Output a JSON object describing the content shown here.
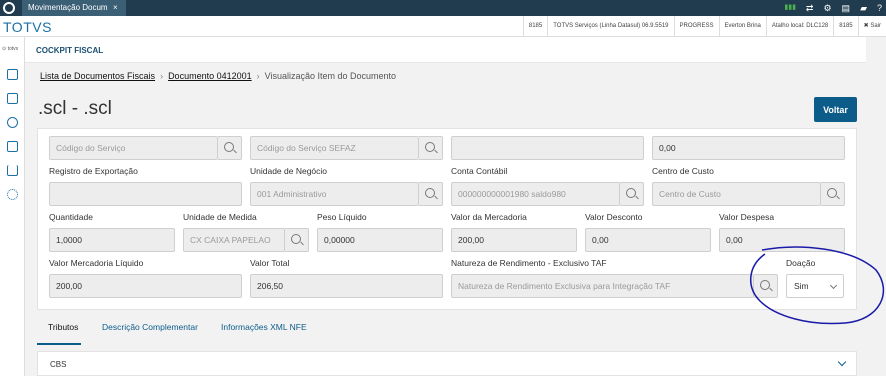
{
  "topbar": {
    "tab_label": "Movimentação Docum",
    "tab_close": "×",
    "icons": [
      "signal-icon",
      "shuffle-icon",
      "gear-icon",
      "document-icon",
      "chat-icon",
      "help-icon"
    ]
  },
  "header": {
    "brand": "TOTVS",
    "info": [
      "8185",
      "TOTVS Serviços (Linha Datasul) 06.9.5519",
      "PROGRESS",
      "Everton Brina",
      "Atalho local: DLC128",
      "8185",
      "✖ Sair"
    ]
  },
  "sidebar": {
    "brand": "⊙ totvs",
    "icons": [
      "document-icon",
      "calculator-icon",
      "dollar-icon",
      "file-icon",
      "download-icon",
      "gear-icon"
    ]
  },
  "module_title": "COCKPIT FISCAL",
  "breadcrumb": {
    "item1": "Lista de Documentos Fiscais",
    "item2": "Documento 0412001",
    "current": "Visualização Item do Documento",
    "sep": "›"
  },
  "page_title": ".scl - .scl",
  "voltar_label": "Voltar",
  "form": {
    "row0": {
      "codigo_servico_ph": "Código do Serviço",
      "codigo_sefaz_ph": "Código do Serviço SEFAZ",
      "campo3_value": "",
      "campo4_value": "0,00"
    },
    "row1": {
      "registro_label": "Registro de Exportação",
      "registro_value": "",
      "unidade_negocio_label": "Unidade de Negócio",
      "unidade_negocio_value": "001  Administrativo",
      "conta_label": "Conta Contábil",
      "conta_value": "000000000001980  saldo980",
      "centro_label": "Centro de Custo",
      "centro_ph": "Centro de Custo"
    },
    "row2": {
      "quantidade_label": "Quantidade",
      "quantidade_value": "1,0000",
      "unidade_medida_label": "Unidade de Medida",
      "unidade_medida_value": "CX  CAIXA PAPELAO",
      "peso_label": "Peso Líquido",
      "peso_value": "0,00000",
      "valor_merc_label": "Valor da Mercadoria",
      "valor_merc_value": "200,00",
      "valor_desc_label": "Valor Desconto",
      "valor_desc_value": "0,00",
      "valor_desp_label": "Valor Despesa",
      "valor_desp_value": "0,00"
    },
    "row3": {
      "vml_label": "Valor Mercadoria Líquido",
      "vml_value": "200,00",
      "total_label": "Valor Total",
      "total_value": "206,50",
      "natureza_label": "Natureza de Rendimento - Exclusivo TAF",
      "natureza_ph": "Natureza de Rendimento Exclusiva para Integração TAF",
      "doacao_label": "Doação",
      "doacao_value": "Sim"
    }
  },
  "tabs": [
    "Tributos",
    "Descrição Complementar",
    "Informações XML NFE"
  ],
  "accordion": {
    "label": "CBS"
  },
  "colors": {
    "primary": "#0c5c8a",
    "topbar": "#203c4e",
    "annotation": "#1a1aa8"
  }
}
